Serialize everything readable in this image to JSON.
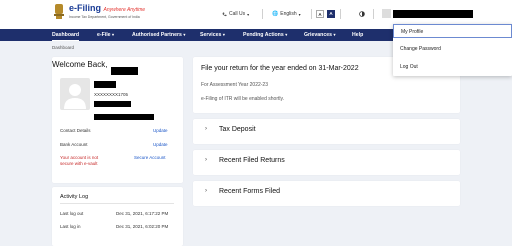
{
  "header": {
    "brand_title": "e-Filing",
    "brand_tagline": "Anywhere Anytime",
    "brand_subtitle": "Income Tax Department, Government of India",
    "call_us": "Call Us",
    "language": "English",
    "font_small": "A",
    "font_large": "A"
  },
  "nav": {
    "items": [
      "Dashboard",
      "e-File",
      "Authorised Partners",
      "Services",
      "Pending Actions",
      "Grievances",
      "Help"
    ]
  },
  "profile_menu": {
    "items": [
      "My Profile",
      "Change Password",
      "Log Out"
    ]
  },
  "breadcrumb": "Dashboard",
  "profile_card": {
    "welcome": "Welcome Back,",
    "pan_masked": "XXXXXXXX1705",
    "contact_label": "Contact Details",
    "contact_action": "Update",
    "bank_label": "Bank Account",
    "bank_action": "Update",
    "secure_line1": "Your account is not",
    "secure_line2": "secure with e-vault",
    "secure_action": "Secure Account"
  },
  "activity_log": {
    "title": "Activity Log",
    "rows": [
      {
        "label": "Last log out",
        "value": "Dec 31, 2021, 6:17:22 PM"
      },
      {
        "label": "Last log in",
        "value": "Dec 31, 2021, 6:02:20 PM"
      }
    ]
  },
  "return_panel": {
    "title": "File your return for the year ended on 31-Mar-2022",
    "assessment_year": "For Assessment Year 2022-23",
    "enabled_note": "e-Filing of ITR will be enabled shortly."
  },
  "accordion": [
    "Tax Deposit",
    "Recent Filed Returns",
    "Recent Forms Filed"
  ],
  "colors": {
    "nav_bg": "#1e2f6c",
    "link": "#1a56c8",
    "page_bg": "#eef1f6"
  }
}
